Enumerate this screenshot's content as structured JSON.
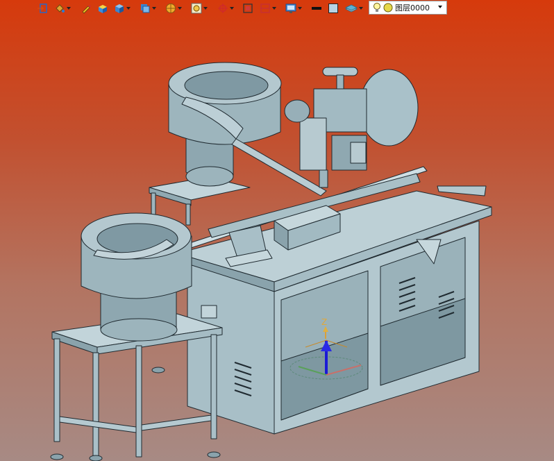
{
  "toolbar": {
    "items": [
      {
        "name": "exit-icon"
      },
      {
        "name": "paint-bucket-icon",
        "dropdown": true
      },
      {
        "name": "pen-icon"
      },
      {
        "name": "box-shaded-icon"
      },
      {
        "name": "cube-icon",
        "dropdown": true
      },
      {
        "name": "cube-faces-icon",
        "dropdown": true
      },
      {
        "name": "sphere-display-icon",
        "dropdown": true
      },
      {
        "name": "zoom-view-icon",
        "dropdown": true
      },
      {
        "name": "crosshair-icon",
        "dropdown": true
      },
      {
        "name": "frame-icon"
      },
      {
        "name": "section-view-icon",
        "dropdown": true
      },
      {
        "name": "monitor-icon",
        "dropdown": true
      },
      {
        "name": "line-color-swatch",
        "color": "#111111"
      },
      {
        "name": "fill-color-swatch",
        "color": "#b7d3e4"
      },
      {
        "name": "layer-stack-icon",
        "dropdown": true
      }
    ],
    "layer_label": "图层0000"
  },
  "viewport": {
    "background_top": "#d63a0c",
    "background_bottom": "#a78a84",
    "model_color": "#a9c1cb",
    "triad_label": "Z"
  }
}
